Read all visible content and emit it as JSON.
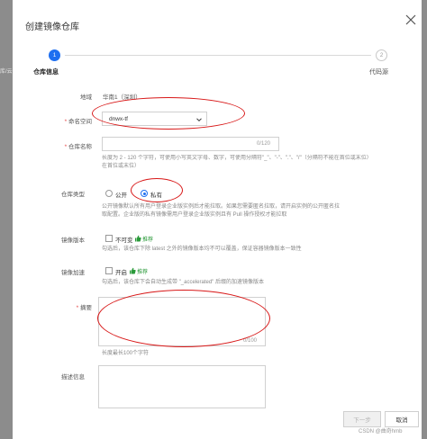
{
  "background": {
    "left_text": "库/云"
  },
  "dialog": {
    "title": "创建镜像仓库"
  },
  "steps": [
    {
      "number": "1",
      "label": "仓库信息"
    },
    {
      "number": "2",
      "label": "代码源"
    }
  ],
  "form": {
    "region": {
      "label": "地域",
      "value": "华南1（深圳）"
    },
    "namespace": {
      "label": "命名空间",
      "value": "dnwx-tf"
    },
    "repo_name": {
      "label": "仓库名称",
      "value": "",
      "counter": "0/120",
      "help_line1": "长度为 2 - 120 个字符，可使用小写英文字母、数字，可使用分隔符\"_\"、\"-\"、\".\"、\"/\"（分隔符不能在首位或末位）",
      "help_line2": "在首位或末位）"
    },
    "repo_type": {
      "label": "仓库类型",
      "options": [
        "公开",
        "私有"
      ],
      "selected": "私有",
      "help_line1": "公开镜像默认所有用户登录企业版实例后才能拉取。如果您需要匿名拉取，请开启实例的公开匿名拉",
      "help_line2": "取配置。企业版的私有镜像需用户登录企业版实例且有 Pull 操作授权才能拉取"
    },
    "image_version": {
      "label": "镜像版本",
      "checkbox_label": "不可变",
      "badge": "推荐",
      "help": "勾选后，该仓库下除 latest 之外的镜像版本均不可以覆盖，保证容器镜像版本一致性"
    },
    "image_accel": {
      "label": "镜像加速",
      "checkbox_label": "开启",
      "badge": "推荐",
      "help": "勾选后，该仓库下会自动生成带 \"_accelerated\" 后缀的加速镜像版本"
    },
    "summary": {
      "label": "摘要",
      "value": "",
      "counter": "0/100",
      "help": "长度最长100个字符"
    },
    "description": {
      "label": "描述信息",
      "value": ""
    }
  },
  "footer": {
    "next_label": "下一步",
    "cancel_label": "取消",
    "watermark": "CSDN @曲奇hmb"
  },
  "colors": {
    "primary": "#1e6ff0",
    "annotation_red": "#d81818",
    "recommend_green": "#2a9a3a"
  },
  "icons": [
    "close-icon",
    "chevron-down-icon",
    "thumbs-up-icon"
  ]
}
